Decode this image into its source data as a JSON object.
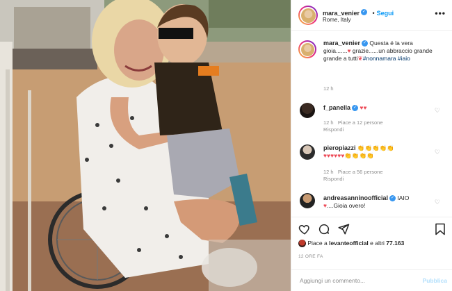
{
  "post": {
    "header": {
      "username": "mara_venier",
      "follow_label": "Segui",
      "location": "Rome, Italy",
      "more_icon": "more-dots-icon"
    },
    "caption": {
      "username": "mara_venier",
      "text_a": "Questa é la vera gioia.......",
      "text_b": " grazie......un abbraccio grande grande a tutti",
      "hashtag_1": "#nonnamara",
      "hashtag_2": "#iaio",
      "time": "12 h"
    },
    "comments": [
      {
        "username": "f_panella",
        "emoji": "♥♥",
        "time": "12 h",
        "likes": "Piace a 12 persone",
        "reply": "Rispondi"
      },
      {
        "username": "pieropiazzi",
        "emoji_line1": "👏👏👏👏👏",
        "emoji_line2": "♥♥♥♥♥♥👏👏👏👏",
        "time": "12 h",
        "likes": "Piace a 56 persone",
        "reply": "Rispondi"
      },
      {
        "username": "andreasanninoofficial",
        "text_a": "IAIO",
        "text_b": "....Gioia overo!"
      }
    ],
    "actions": {
      "like_icon": "heart-icon",
      "comment_icon": "comment-icon",
      "share_icon": "share-icon",
      "save_icon": "bookmark-icon"
    },
    "likes_prefix": "Piace a ",
    "likes_user": "levanteofficial",
    "likes_suffix": " e altri ",
    "likes_count": "77.163",
    "timestamp": "12 ORE FA",
    "add_comment": {
      "placeholder": "Aggiungi un commento...",
      "publish_label": "Pubblica"
    },
    "colors": {
      "accent": "#0095f6",
      "verified": "#3897f0",
      "heart": "#ed4956",
      "muted": "#8e8e8e"
    }
  }
}
